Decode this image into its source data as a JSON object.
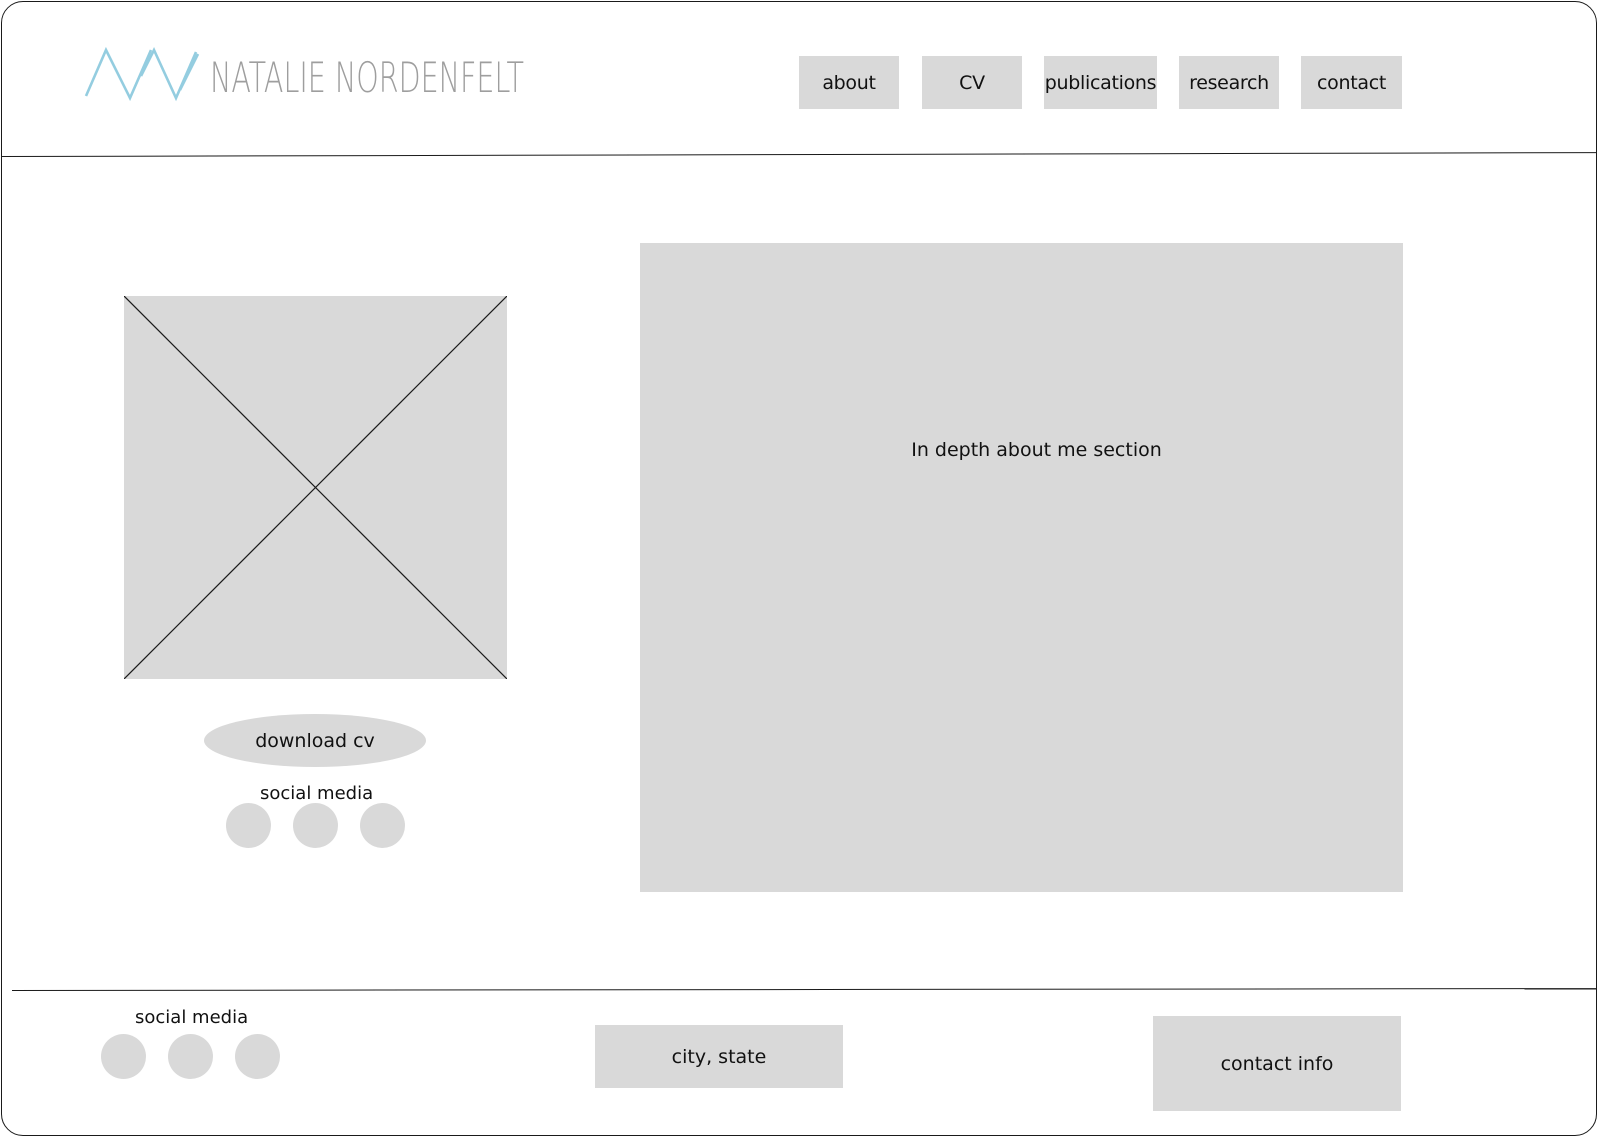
{
  "header": {
    "logo_text": "NATALIE NORDENFELT",
    "logo_color": "#94cde0",
    "nav": [
      {
        "label": "about"
      },
      {
        "label": "CV"
      },
      {
        "label": "publications"
      },
      {
        "label": "research"
      },
      {
        "label": "contact"
      }
    ]
  },
  "main": {
    "download_label": "download cv",
    "social_label": "social media",
    "about_text": "In depth about me section"
  },
  "footer": {
    "social_label": "social media",
    "location": "city, state",
    "contact": "contact info"
  },
  "colors": {
    "placeholder": "#d9d9d9",
    "line": "#1a1a1a",
    "logo_text": "#9e9e9e"
  }
}
